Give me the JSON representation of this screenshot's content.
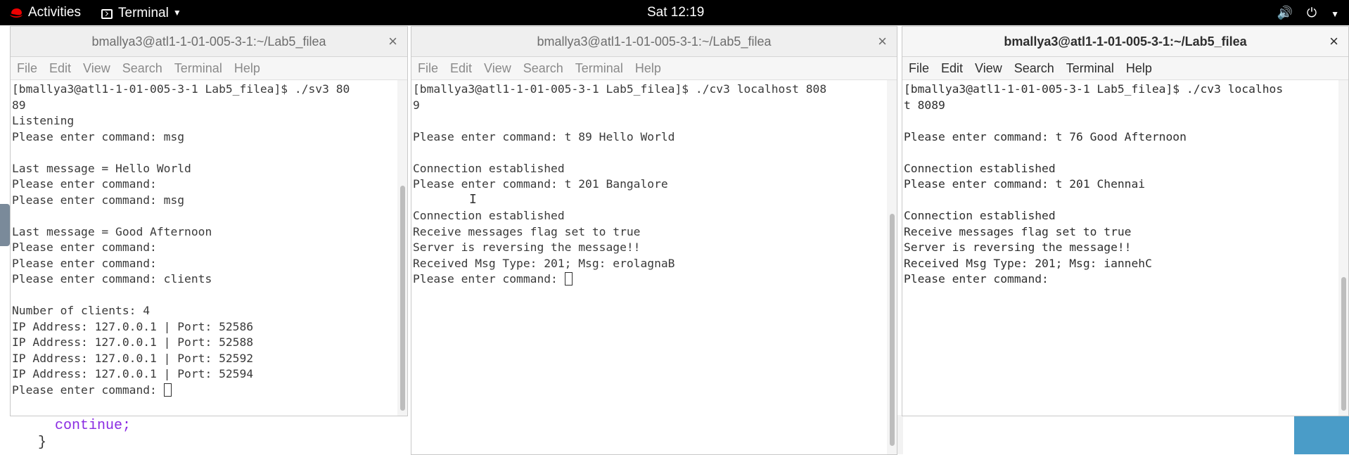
{
  "topbar": {
    "activities": "Activities",
    "app": "Terminal",
    "clock": "Sat 12:19",
    "volume_icon": "volume-icon",
    "power_icon": "power-icon"
  },
  "background_editor": {
    "line1": "continue;",
    "line2": "}"
  },
  "menu": [
    "File",
    "Edit",
    "View",
    "Search",
    "Terminal",
    "Help"
  ],
  "windows": [
    {
      "title": "bmallya3@atl1-1-01-005-3-1:~/Lab5_filea",
      "close": "×",
      "lines": [
        "[bmallya3@atl1-1-01-005-3-1 Lab5_filea]$ ./sv3 80",
        "89",
        "Listening",
        "",
        "Please enter command: msg",
        "",
        "Last message = Hello World",
        "Please enter command:",
        "Please enter command: msg",
        "",
        "Last message = Good Afternoon",
        "Please enter command:",
        "Please enter command:",
        "Please enter command: clients",
        "",
        "Number of clients: 4",
        "IP Address: 127.0.0.1 | Port: 52586",
        "IP Address: 127.0.0.1 | Port: 52588",
        "IP Address: 127.0.0.1 | Port: 52592",
        "IP Address: 127.0.0.1 | Port: 52594",
        "Please enter command: "
      ]
    },
    {
      "title": "bmallya3@atl1-1-01-005-3-1:~/Lab5_filea",
      "close": "×",
      "lines": [
        "[bmallya3@atl1-1-01-005-3-1 Lab5_filea]$ ./cv3 localhost 808",
        "9",
        "",
        "Please enter command: t 89 Hello World",
        "",
        "Connection established",
        "Please enter command: t 201 Bangalore",
        "",
        "Connection established",
        "Receive messages flag set to true",
        "Server is reversing the message!!",
        "Received Msg Type: 201; Msg: erolagnaB",
        "Please enter command: "
      ]
    },
    {
      "title": "bmallya3@atl1-1-01-005-3-1:~/Lab5_filea",
      "close": "×",
      "lines": [
        "[bmallya3@atl1-1-01-005-3-1 Lab5_filea]$ ./cv3 localhos",
        "t 8089",
        "",
        "Please enter command: t 76 Good Afternoon",
        "",
        "Connection established",
        "Please enter command: t 201 Chennai",
        "",
        "Connection established",
        "Receive messages flag set to true",
        "Server is reversing the message!!",
        "Received Msg Type: 201; Msg: iannehC",
        "Please enter command:"
      ]
    }
  ]
}
